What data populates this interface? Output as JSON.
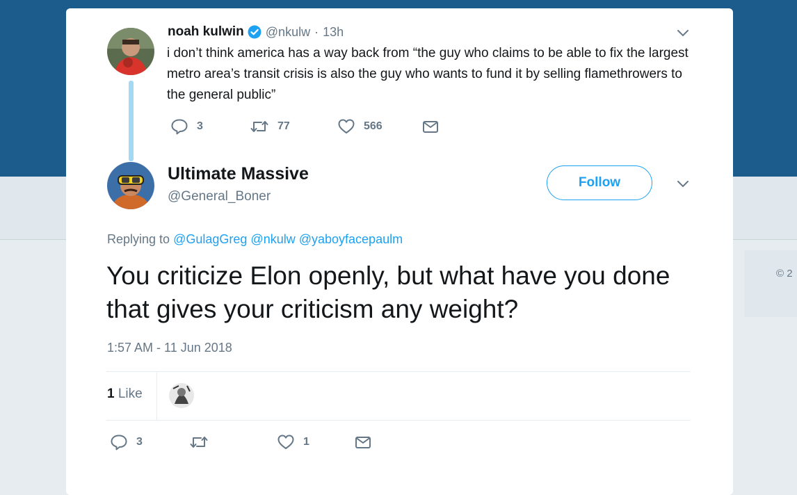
{
  "background": {
    "copyright_fragment": "© 2"
  },
  "parent_tweet": {
    "name": "noah kulwin",
    "handle": "@nkulw",
    "separator": "·",
    "time": "13h",
    "text": "i don’t think america has a way back from “the guy who claims to be able to fix the largest metro area’s transit crisis is also the guy who wants to fund it by selling flamethrowers to the general public”",
    "replies": "3",
    "retweets": "77",
    "likes": "566",
    "verified": true
  },
  "main_tweet": {
    "name": "Ultimate Massive",
    "handle": "@General_Boner",
    "follow_label": "Follow",
    "replying_prefix": "Replying to",
    "mentions": [
      "@GulagGreg",
      "@nkulw",
      "@yaboyfacepaulm"
    ],
    "text": "You criticize Elon openly, but what have you done that gives your criticism any weight?",
    "timestamp": "1:57 AM - 11 Jun 2018",
    "like_count": "1",
    "like_word": "Like",
    "actions": {
      "replies": "3",
      "retweets": "",
      "likes": "1"
    }
  },
  "colors": {
    "accent": "#1da1f2",
    "header": "#1b5c8c",
    "muted": "#657786",
    "thread_line": "#a4d9f3"
  }
}
